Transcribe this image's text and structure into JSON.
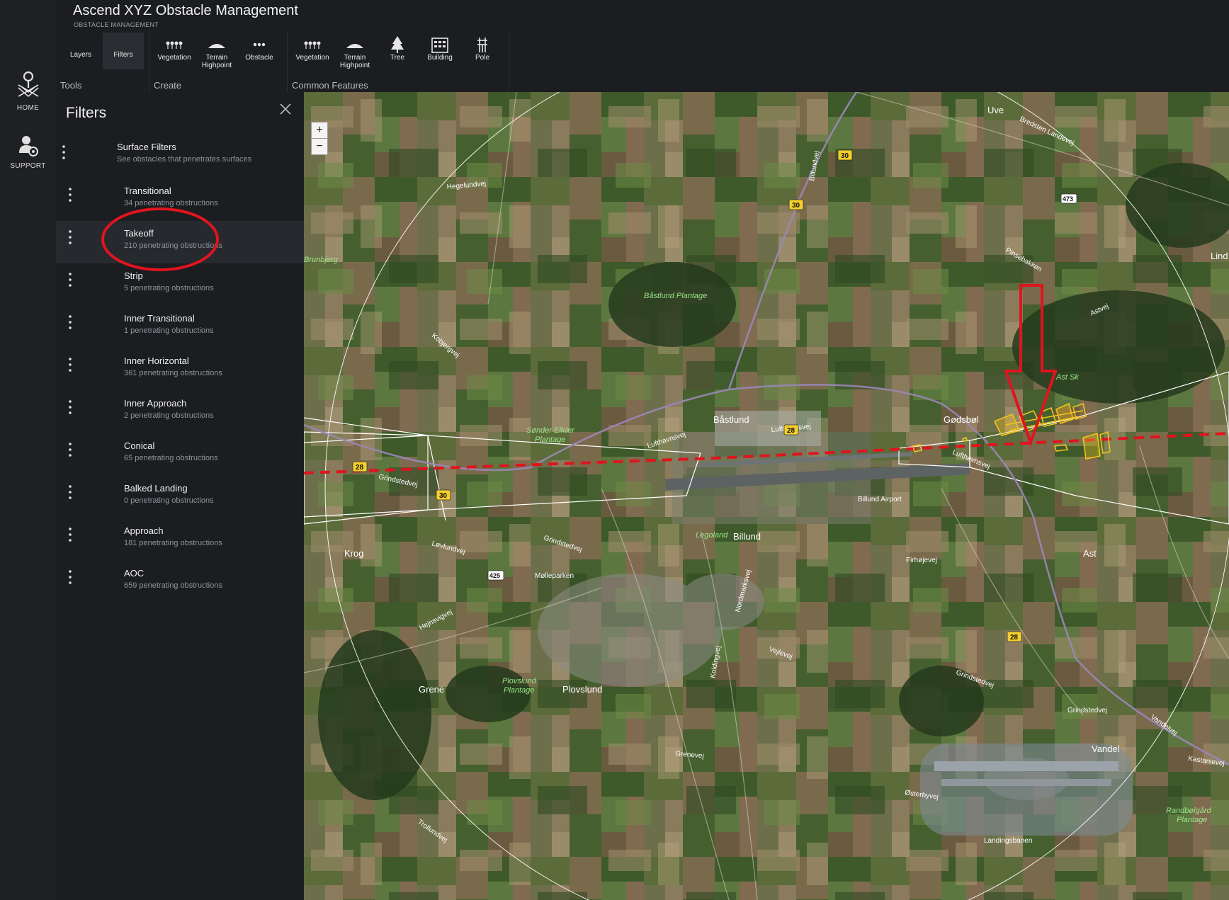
{
  "rail": {
    "home_label": "HOME",
    "support_label": "SUPPORT"
  },
  "header": {
    "title": "Ascend XYZ Obstacle Management",
    "subtitle": "OBSTACLE MANAGEMENT"
  },
  "ribbon": {
    "tools": {
      "label": "Tools",
      "layers": "Layers",
      "filters": "Filters"
    },
    "create": {
      "label": "Create",
      "vegetation": "Vegetation",
      "terrain_highpoint": "Terrain Highpoint",
      "obstacle": "Obstacle"
    },
    "common": {
      "label": "Common Features",
      "vegetation": "Vegetation",
      "terrain_highpoint": "Terrain Highpoint",
      "tree": "Tree",
      "building": "Building",
      "pole": "Pole"
    }
  },
  "panel": {
    "title": "Filters",
    "surface": {
      "name": "Surface Filters",
      "sub": "See obstacles that penetrates surfaces"
    },
    "filters": [
      {
        "name": "Transitional",
        "sub": "34 penetrating obstructions"
      },
      {
        "name": "Takeoff",
        "sub": "210 penetrating obstructions"
      },
      {
        "name": "Strip",
        "sub": "5 penetrating obstructions"
      },
      {
        "name": "Inner Transitional",
        "sub": "1 penetrating obstructions"
      },
      {
        "name": "Inner Horizontal",
        "sub": "361 penetrating obstructions"
      },
      {
        "name": "Inner Approach",
        "sub": "2 penetrating obstructions"
      },
      {
        "name": "Conical",
        "sub": "65 penetrating obstructions"
      },
      {
        "name": "Balked Landing",
        "sub": "0 penetrating obstructions"
      },
      {
        "name": "Approach",
        "sub": "181 penetrating obstructions"
      },
      {
        "name": "AOC",
        "sub": "659 penetrating obstructions"
      }
    ]
  },
  "map": {
    "zoom_in": "+",
    "zoom_out": "−",
    "places": {
      "uve": "Uve",
      "brunbjerg": "Brunbjerg",
      "bastlund": "Båstlund",
      "godsbol": "Gødsbøl",
      "billund_airport": "Billund Airport",
      "billund": "Billund",
      "legoland": "Legoland",
      "krog": "Krog",
      "ast": "Ast",
      "ast_sk": "Ast Sk",
      "grene": "Grene",
      "plovslund": "Plovslund",
      "vandel": "Vandel",
      "landingsbanen": "Landingsbanen",
      "molleparken": "Mølleparken",
      "lind": "Lind"
    },
    "green_areas": {
      "bastlund_plantage": "Båstlund Plantage",
      "sonder_elkaer_1": "Sønder Elkær",
      "sonder_elkaer_2": "Plantage",
      "plovslund_plantage_1": "Plovslund",
      "plovslund_plantage_2": "Plantage",
      "randbol_1": "Randbølgård",
      "randbol_2": "Plantage"
    },
    "roads": {
      "bredsten": "Bredsten Landevej",
      "lufthavnsvej": "Lufthavnsvej",
      "grindstedvej": "Grindstedvej",
      "hegelundvej": "Hegelundvej",
      "billundvej": "Billundvej",
      "pinsebakken": "Pinsebakken",
      "vejlevej": "Vejlevej",
      "grenevej": "Grenevej",
      "osterbyvej": "Østerbyvej",
      "koldingvej": "Koldingvej",
      "firhojevej": "Firhøjevej",
      "nordmarksvej": "Nordmarksvej",
      "vandelvej": "Vandelvej",
      "kastanievej": "Kastanievej",
      "hejnsvigvej": "Hejnsvigvej",
      "trollundvej": "Trollundvej",
      "lovlundvej": "Løvlundvej",
      "kobjergvej": "Kobjergvej",
      "astvej": "Astvej"
    },
    "shields": {
      "r28": "28",
      "r30": "30",
      "r473": "473",
      "r425": "425"
    }
  },
  "colors": {
    "annotation_red": "#e0141e",
    "obstacle_yellow": "#f2c21a",
    "surface_outline": "#ffffff",
    "route_purple": "#9b87b8"
  }
}
